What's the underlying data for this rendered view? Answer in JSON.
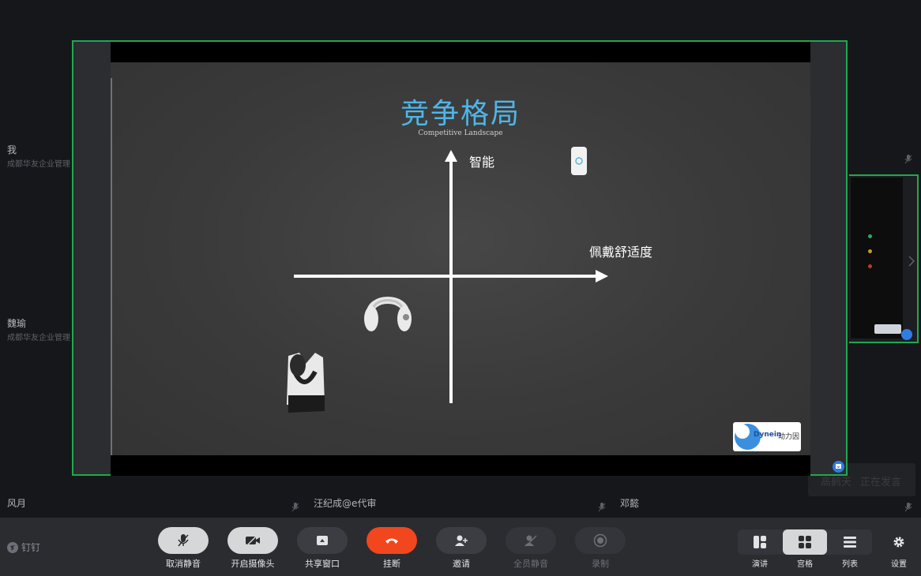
{
  "participants": {
    "self": {
      "name": "我",
      "org": "成都华友企业管理"
    },
    "weiyu": {
      "name": "魏瑜",
      "org": "成都华友企业管理"
    },
    "fengyue": {
      "name": "风月"
    },
    "wangjicheng": {
      "name": "汪纪成@e代审"
    },
    "dengyi": {
      "name": "邓懿"
    }
  },
  "slide": {
    "title": "竞争格局",
    "subtitle": "Competitive Landscape",
    "y_axis_label": "智能",
    "x_axis_label": "佩戴舒适度",
    "logo_text": "Dynein",
    "logo_cn": "动力因"
  },
  "speaking": {
    "name": "高鹤天",
    "status": "正在发言"
  },
  "app": {
    "logo_label": "钉钉"
  },
  "toolbar": {
    "unmute": "取消静音",
    "camera": "开启摄像头",
    "share": "共享窗口",
    "hangup": "挂断",
    "invite": "邀请",
    "mute_all": "全员静音",
    "record": "录制"
  },
  "views": {
    "speaker": "演讲",
    "grid": "宫格",
    "list": "列表",
    "settings": "设置"
  },
  "colors": {
    "accent_green": "#1fa84f",
    "hangup_red": "#f2461f",
    "title_blue": "#4eb6e8",
    "toolbar_bg": "#2a2c30"
  }
}
